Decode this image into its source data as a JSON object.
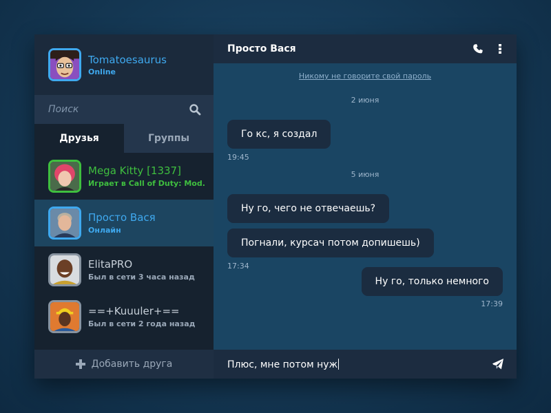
{
  "colors": {
    "accent": "#3fa9ef",
    "ingame": "#3fbf3f",
    "offline": "#9aa8b8",
    "sidebar_bg": "#1d2c3f",
    "chat_bg": "#1a4563",
    "bubble_bg": "#1b2c40"
  },
  "profile": {
    "name": "Tomatoesaurus",
    "status": "Online",
    "avatar": "cartoon-face-avatar"
  },
  "search": {
    "placeholder": "Поиск",
    "icon": "search-icon"
  },
  "tabs": [
    {
      "label": "Друзья",
      "active": true
    },
    {
      "label": "Группы",
      "active": false
    }
  ],
  "friends": [
    {
      "name": "Mega Kitty [1337]",
      "status": "Играет в Call of Duty: Mod...",
      "state": "ingame"
    },
    {
      "name": "Просто Вася",
      "status": "Онлайн",
      "state": "online",
      "selected": true
    },
    {
      "name": "ElitaPRO",
      "status": "Был в сети 3 часа назад",
      "state": "offline"
    },
    {
      "name": "==+Kuuuler+==",
      "status": "Был в сети 2 года назад",
      "state": "offline"
    }
  ],
  "add_friend": {
    "label": "Добавить друга",
    "icon": "plus-icon"
  },
  "chat": {
    "title": "Просто Вася",
    "header_icons": [
      "phone-icon",
      "more-vertical-icon"
    ],
    "notice": "Никому не говорите свой пароль",
    "groups": [
      {
        "date": "2 июня",
        "messages": [
          {
            "text": "Го кс, я создал",
            "outgoing": false
          }
        ],
        "time": "19:45"
      },
      {
        "date": "5 июня",
        "messages": [
          {
            "text": "Ну го, чего не отвечаешь?",
            "outgoing": false
          },
          {
            "text": "Погнали, курсач потом допишешь)",
            "outgoing": false
          }
        ],
        "time": "17:34"
      },
      {
        "messages": [
          {
            "text": "Ну го, только немного",
            "outgoing": true
          }
        ],
        "time": "17:39"
      }
    ]
  },
  "composer": {
    "value": "Плюс, мне потом нуж",
    "send_icon": "send-icon"
  }
}
